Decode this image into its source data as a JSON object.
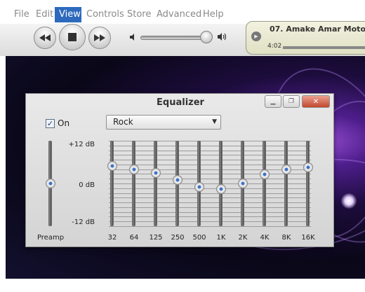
{
  "menu": {
    "items": [
      {
        "label": "File"
      },
      {
        "label": "Edit"
      },
      {
        "label": "View"
      },
      {
        "label": "Controls"
      },
      {
        "label": "Store"
      },
      {
        "label": "Advanced"
      },
      {
        "label": "Help"
      }
    ],
    "active": "View"
  },
  "toolbar": {
    "prev_icon": "rewind-icon",
    "stop_icon": "stop-icon",
    "next_icon": "fast-forward-icon",
    "volume_low_icon": "speaker-low-icon",
    "volume_high_icon": "speaker-high-icon",
    "volume_level": 0.9
  },
  "now_playing": {
    "title": "07. Amake Amar Moto",
    "elapsed": "4:02"
  },
  "equalizer": {
    "title": "Equalizer",
    "on_label": "On",
    "on_checked": true,
    "preset": "Rock",
    "db_top": "+12 dB",
    "db_mid": "0 dB",
    "db_bottom": "-12 dB",
    "preamp": {
      "label": "Preamp",
      "value_db": 0
    },
    "bands": [
      {
        "label": "32",
        "value_db": 5
      },
      {
        "label": "64",
        "value_db": 4
      },
      {
        "label": "125",
        "value_db": 3
      },
      {
        "label": "250",
        "value_db": 1
      },
      {
        "label": "500",
        "value_db": -1
      },
      {
        "label": "1K",
        "value_db": -1.5
      },
      {
        "label": "2K",
        "value_db": 0
      },
      {
        "label": "4K",
        "value_db": 2.5
      },
      {
        "label": "8K",
        "value_db": 4
      },
      {
        "label": "16K",
        "value_db": 4.5
      }
    ],
    "window_buttons": [
      "minimize-icon",
      "restore-icon",
      "close-icon"
    ]
  }
}
